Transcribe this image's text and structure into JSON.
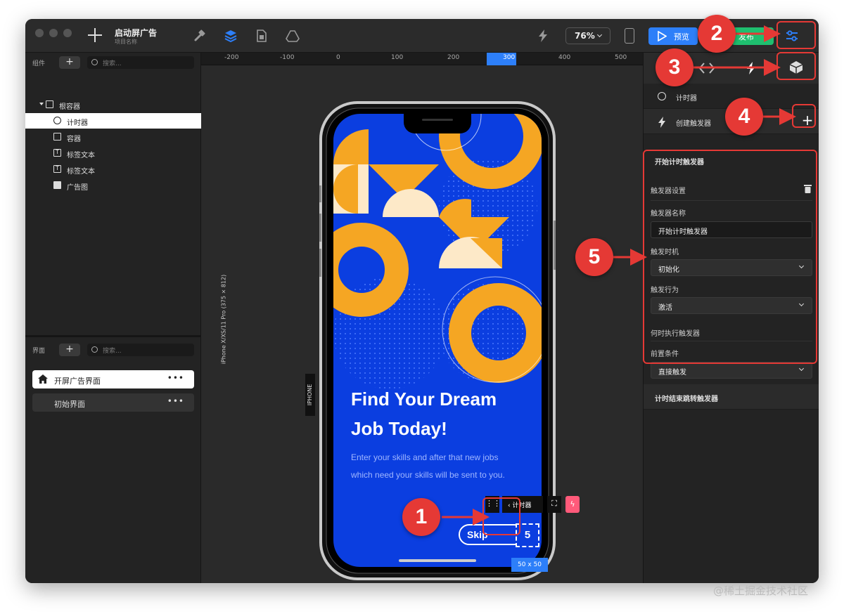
{
  "app": {
    "title": "启动屏广告",
    "subtitle": "项目名称",
    "zoom": "76%",
    "preview_label": "预览",
    "publish_label": "发布"
  },
  "components_panel": {
    "header": "组件",
    "search_placeholder": "搜索...",
    "tree": [
      {
        "label": "根容器",
        "icon": "container-icon"
      },
      {
        "label": "计时器",
        "icon": "timer-icon"
      },
      {
        "label": "容器",
        "icon": "container-icon"
      },
      {
        "label": "标签文本",
        "icon": "text-icon"
      },
      {
        "label": "标签文本",
        "icon": "text-icon"
      },
      {
        "label": "广告图",
        "icon": "image-icon"
      }
    ]
  },
  "screens_panel": {
    "header": "界面",
    "search_placeholder": "搜索...",
    "items": [
      {
        "label": "开屏广告界面",
        "icon": "home-icon",
        "more": "•••"
      },
      {
        "label": "初始界面",
        "more": "•••"
      }
    ]
  },
  "ruler": {
    "ticks": [
      "-200",
      "-100",
      "0",
      "100",
      "200",
      "300",
      "400",
      "500"
    ]
  },
  "device": {
    "name": "iPhone X/XS/11 Pro (375 × 812)",
    "badge": "IPHONE"
  },
  "ad_screen": {
    "headline_1": "Find Your Dream",
    "headline_2": "Job Today!",
    "body_1": "Enter your skills and after that new jobs",
    "body_2": "which need your skills will be sent to you.",
    "skip_label": "Skip",
    "timer_value": "5",
    "selection_size": "50 x 50",
    "toolbar_label": "计时器"
  },
  "properties_panel": {
    "timer_row": "计时器",
    "create_trigger_row": "创建触发器",
    "trigger_1_title": "开始计时触发器",
    "settings_title": "触发器设置",
    "name_label": "触发器名称",
    "name_value": "开始计时触发器",
    "timing_label": "触发时机",
    "timing_value": "初始化",
    "action_label": "触发行为",
    "action_value": "激活",
    "when_label": "何时执行触发器",
    "precondition_label": "前置条件",
    "precondition_value": "直接触发",
    "trigger_2_title": "计时结束跳转触发器"
  },
  "annotations": [
    "1",
    "2",
    "3",
    "4",
    "5"
  ],
  "watermark": "@稀土掘金技术社区",
  "colors": {
    "accent_blue": "#2d7ff9",
    "publish_green": "#1fbf6f",
    "annotation_red": "#e53935",
    "ad_blue": "#0b3ee0",
    "ad_orange": "#f5a623",
    "ad_cream": "#fde9c8"
  }
}
